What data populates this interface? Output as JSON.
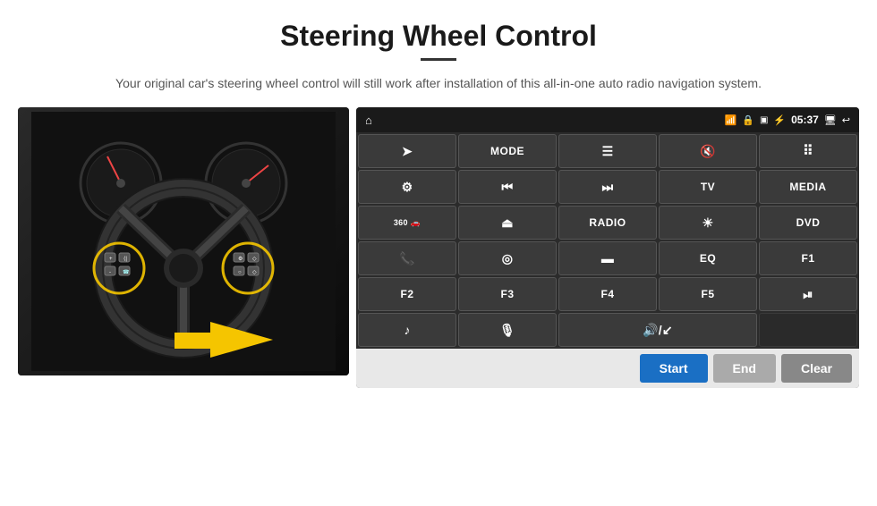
{
  "page": {
    "title": "Steering Wheel Control",
    "subtitle": "Your original car's steering wheel control will still work after installation of this all-in-one auto radio navigation system."
  },
  "statusBar": {
    "time": "05:37",
    "icons": [
      "wifi",
      "lock",
      "sim",
      "bluetooth",
      "monitor",
      "back"
    ]
  },
  "buttons": [
    {
      "id": "nav",
      "type": "icon",
      "icon": "⌂",
      "row": 1
    },
    {
      "id": "send",
      "type": "icon",
      "icon": "➤",
      "row": 1
    },
    {
      "id": "mode",
      "type": "text",
      "label": "MODE",
      "row": 1
    },
    {
      "id": "list",
      "type": "icon",
      "icon": "☰",
      "row": 1
    },
    {
      "id": "mute",
      "type": "icon",
      "icon": "🔇",
      "row": 1
    },
    {
      "id": "apps",
      "type": "icon",
      "icon": "⠿",
      "row": 1
    },
    {
      "id": "settings",
      "type": "icon",
      "icon": "⚙",
      "row": 2
    },
    {
      "id": "prev",
      "type": "icon",
      "icon": "⏮",
      "row": 2
    },
    {
      "id": "next",
      "type": "icon",
      "icon": "⏭",
      "row": 2
    },
    {
      "id": "tv",
      "type": "text",
      "label": "TV",
      "row": 2
    },
    {
      "id": "media",
      "type": "text",
      "label": "MEDIA",
      "row": 2
    },
    {
      "id": "360",
      "type": "text",
      "label": "360 🚗",
      "row": 3
    },
    {
      "id": "eject",
      "type": "icon",
      "icon": "⏏",
      "row": 3
    },
    {
      "id": "radio",
      "type": "text",
      "label": "RADIO",
      "row": 3
    },
    {
      "id": "bright",
      "type": "icon",
      "icon": "☀",
      "row": 3
    },
    {
      "id": "dvd",
      "type": "text",
      "label": "DVD",
      "row": 3
    },
    {
      "id": "phone",
      "type": "icon",
      "icon": "📞",
      "row": 4
    },
    {
      "id": "nav2",
      "type": "icon",
      "icon": "◎",
      "row": 4
    },
    {
      "id": "screen",
      "type": "icon",
      "icon": "▬",
      "row": 4
    },
    {
      "id": "eq",
      "type": "text",
      "label": "EQ",
      "row": 4
    },
    {
      "id": "f1",
      "type": "text",
      "label": "F1",
      "row": 4
    },
    {
      "id": "f2",
      "type": "text",
      "label": "F2",
      "row": 5
    },
    {
      "id": "f3",
      "type": "text",
      "label": "F3",
      "row": 5
    },
    {
      "id": "f4",
      "type": "text",
      "label": "F4",
      "row": 5
    },
    {
      "id": "f5",
      "type": "text",
      "label": "F5",
      "row": 5
    },
    {
      "id": "playpause",
      "type": "icon",
      "icon": "⏯",
      "row": 5
    },
    {
      "id": "music",
      "type": "icon",
      "icon": "♪",
      "row": 6
    },
    {
      "id": "mic",
      "type": "icon",
      "icon": "🎤",
      "row": 6
    },
    {
      "id": "vol",
      "type": "icon",
      "icon": "🔊/↙",
      "row": 6
    }
  ],
  "actionBar": {
    "startLabel": "Start",
    "endLabel": "End",
    "clearLabel": "Clear"
  }
}
